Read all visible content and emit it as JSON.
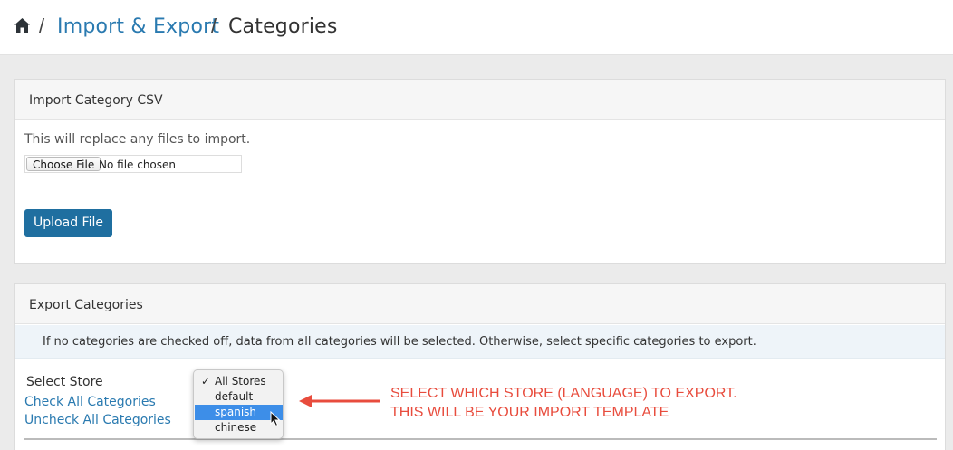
{
  "breadcrumb": {
    "home_icon": "home-icon",
    "separator": "/",
    "link": "Import & Export",
    "current": "Categories"
  },
  "import_panel": {
    "title": "Import Category CSV",
    "description": "This will replace any files to import.",
    "choose_file_label": "Choose File",
    "no_file_text": "No file chosen",
    "upload_button": "Upload File"
  },
  "export_panel": {
    "title": "Export Categories",
    "info": "If no categories are checked off, data from all categories will be selected. Otherwise, select specific categories to export.",
    "select_store_label": "Select Store",
    "check_all": "Check All Categories",
    "uncheck_all": "Uncheck All Categories"
  },
  "store_dropdown": {
    "options": [
      "All Stores",
      "default",
      "spanish",
      "chinese"
    ],
    "checked": "All Stores",
    "highlighted": "spanish",
    "check_mark": "✓"
  },
  "annotation": {
    "line1": "SELECT WHICH STORE (LANGUAGE) TO EXPORT.",
    "line2": "THIS WILL BE YOUR IMPORT TEMPLATE",
    "color": "#e84c3d"
  },
  "colors": {
    "link": "#2a7ab0",
    "primary_button": "#1f6fa0",
    "highlight": "#3d8ee8"
  }
}
